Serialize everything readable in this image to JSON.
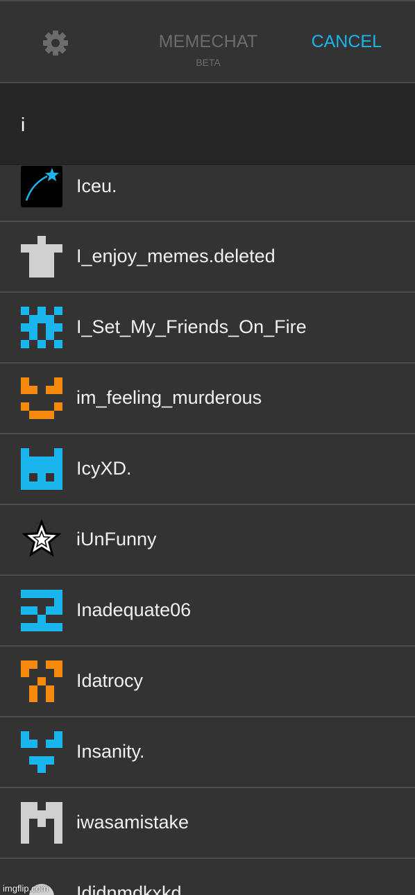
{
  "header": {
    "title": "MEMECHAT",
    "subtitle": "BETA",
    "cancel_label": "CANCEL",
    "settings_icon": "gear-icon"
  },
  "search": {
    "value": "i"
  },
  "users": [
    {
      "name": "Iceu.",
      "avatar": "shooting-star-icon"
    },
    {
      "name": "I_enjoy_memes.deleted",
      "avatar": "gray-pixel-figure-icon"
    },
    {
      "name": "I_Set_My_Friends_On_Fire",
      "avatar": "blue-pixel-pattern-icon"
    },
    {
      "name": "im_feeling_murderous",
      "avatar": "orange-pixel-face-icon"
    },
    {
      "name": "IcyXD.",
      "avatar": "blue-pixel-cat-icon"
    },
    {
      "name": "iUnFunny",
      "avatar": "star-outline-icon"
    },
    {
      "name": "Inadequate06",
      "avatar": "blue-pixel-glyph-icon"
    },
    {
      "name": "Idatrocy",
      "avatar": "orange-pixel-pattern-icon"
    },
    {
      "name": "Insanity.",
      "avatar": "blue-pixel-fox-icon"
    },
    {
      "name": "iwasamistake",
      "avatar": "gray-pixel-m-icon"
    },
    {
      "name": "Ididnmdkxkd",
      "avatar": "gray-circle-avatar-icon"
    }
  ],
  "colors": {
    "accent": "#1ab5ec",
    "orange": "#f58a0c",
    "gray_avatar": "#d0d0d0",
    "background": "#333333",
    "search_background": "#262626"
  },
  "watermark": "imgflip.com"
}
